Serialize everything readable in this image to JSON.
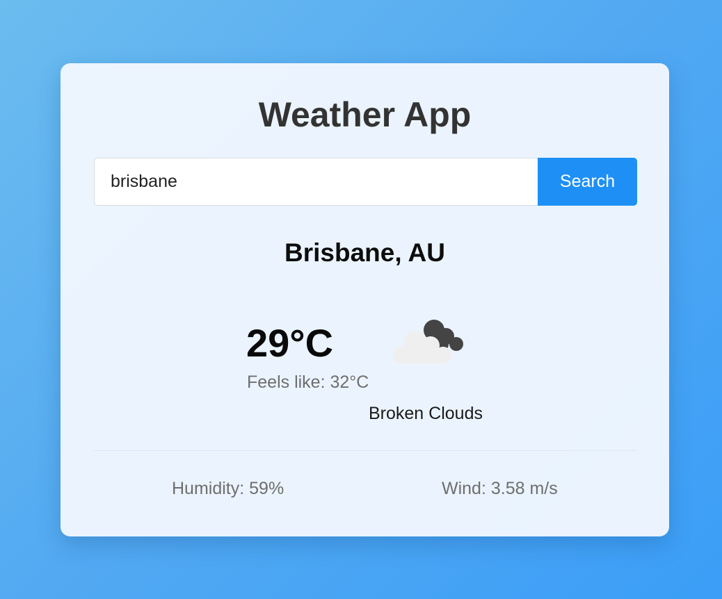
{
  "app": {
    "title": "Weather App"
  },
  "search": {
    "value": "brisbane",
    "button_label": "Search"
  },
  "weather": {
    "location": "Brisbane, AU",
    "temperature": "29°C",
    "feels_like_label": "Feels like:",
    "feels_like_value": "32°C",
    "condition": "Broken Clouds",
    "icon": "broken-clouds-icon",
    "humidity_label": "Humidity:",
    "humidity_value": "59%",
    "wind_label": "Wind:",
    "wind_value": "3.58 m/s"
  },
  "colors": {
    "accent": "#1e90f5",
    "background_start": "#6bbcef",
    "background_end": "#3b9ef7",
    "card": "#f1f7fe"
  }
}
